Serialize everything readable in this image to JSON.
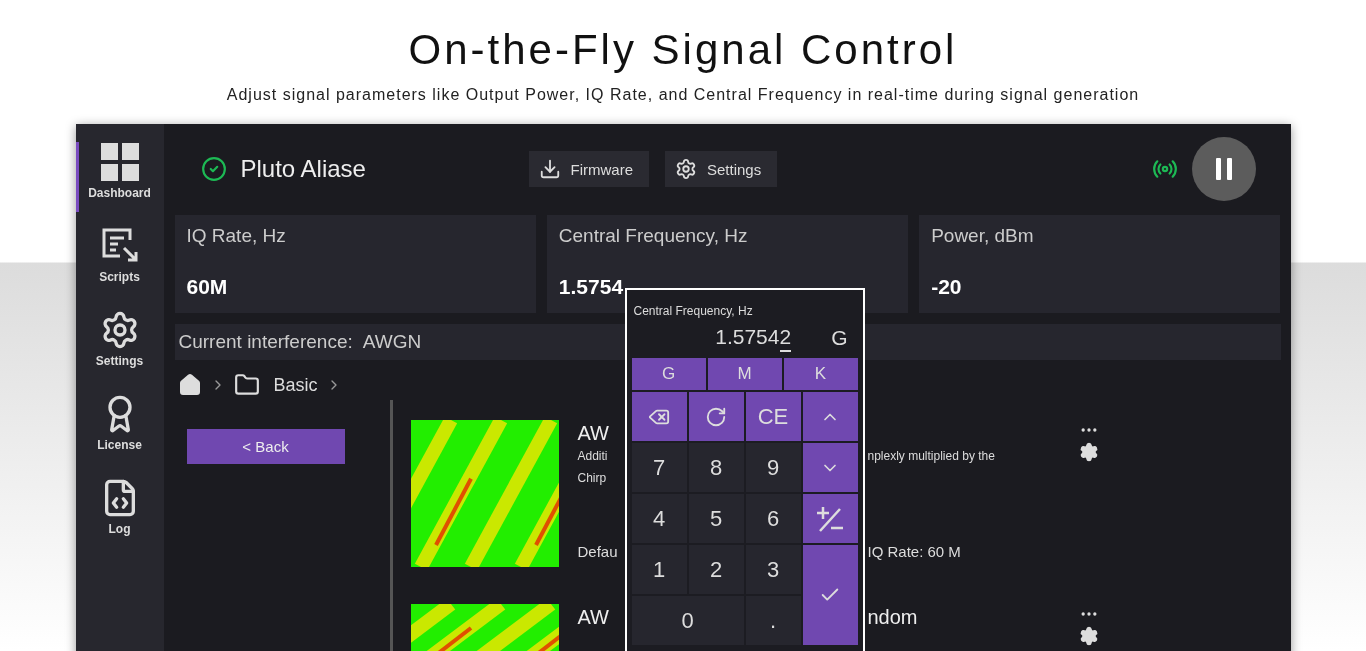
{
  "header": {
    "title": "On-the-Fly Signal Control",
    "subtitle": "Adjust signal parameters like Output Power, IQ Rate, and Central Frequency in real-time during signal generation"
  },
  "sidebar": {
    "items": [
      {
        "label": "Dashboard",
        "kind": "dashboard",
        "selected": true
      },
      {
        "label": "Scripts",
        "kind": "scripts",
        "selected": false
      },
      {
        "label": "Settings",
        "kind": "settings",
        "selected": false
      },
      {
        "label": "License",
        "kind": "license",
        "selected": false
      },
      {
        "label": "Log",
        "kind": "log",
        "selected": false
      }
    ]
  },
  "topbar": {
    "device_name": "Pluto Aliase",
    "connected": true,
    "transmitting": true,
    "buttons": [
      {
        "label": "Firmware",
        "kind": "firmware"
      },
      {
        "label": "Settings",
        "kind": "settings"
      }
    ]
  },
  "parameters": [
    {
      "label": "IQ Rate, Hz",
      "value": "60M"
    },
    {
      "label": "Central Frequency, Hz",
      "value": "1.5754"
    },
    {
      "label": "Power, dBm",
      "value": "-20"
    }
  ],
  "interference": {
    "label": "Current interference:",
    "value": "AWGN"
  },
  "breadcrumb": [
    "Basic"
  ],
  "back_button": "< Back",
  "presets": [
    {
      "title_left": "AW",
      "lines": [
        {
          "left": "Additi",
          "right": "nplexly multiplied by the"
        },
        {
          "left": "Chirp"
        }
      ],
      "footer_left": "Defau",
      "footer_right": "IQ Rate: 60 M"
    },
    {
      "title_left": "AW",
      "title_right": "ndom"
    }
  ],
  "keypad": {
    "label": "Central Frequency, Hz",
    "value": "1.57542",
    "unit": "G",
    "units": [
      {
        "label": "G"
      },
      {
        "label": "M"
      },
      {
        "label": "K"
      }
    ],
    "keys": [
      {
        "kind": "backspace"
      },
      {
        "kind": "reset"
      },
      {
        "kind": "action",
        "label": "CE"
      },
      {
        "kind": "up"
      },
      {
        "kind": "digit",
        "label": "7"
      },
      {
        "kind": "digit",
        "label": "8"
      },
      {
        "kind": "digit",
        "label": "9"
      },
      {
        "kind": "down"
      },
      {
        "kind": "digit",
        "label": "4"
      },
      {
        "kind": "digit",
        "label": "5"
      },
      {
        "kind": "digit",
        "label": "6"
      },
      {
        "kind": "sign"
      },
      {
        "kind": "digit",
        "label": "1"
      },
      {
        "kind": "digit",
        "label": "2"
      },
      {
        "kind": "digit",
        "label": "3"
      },
      {
        "kind": "enter"
      },
      {
        "kind": "zero",
        "label": "0"
      },
      {
        "kind": "digit",
        "label": "."
      }
    ]
  }
}
